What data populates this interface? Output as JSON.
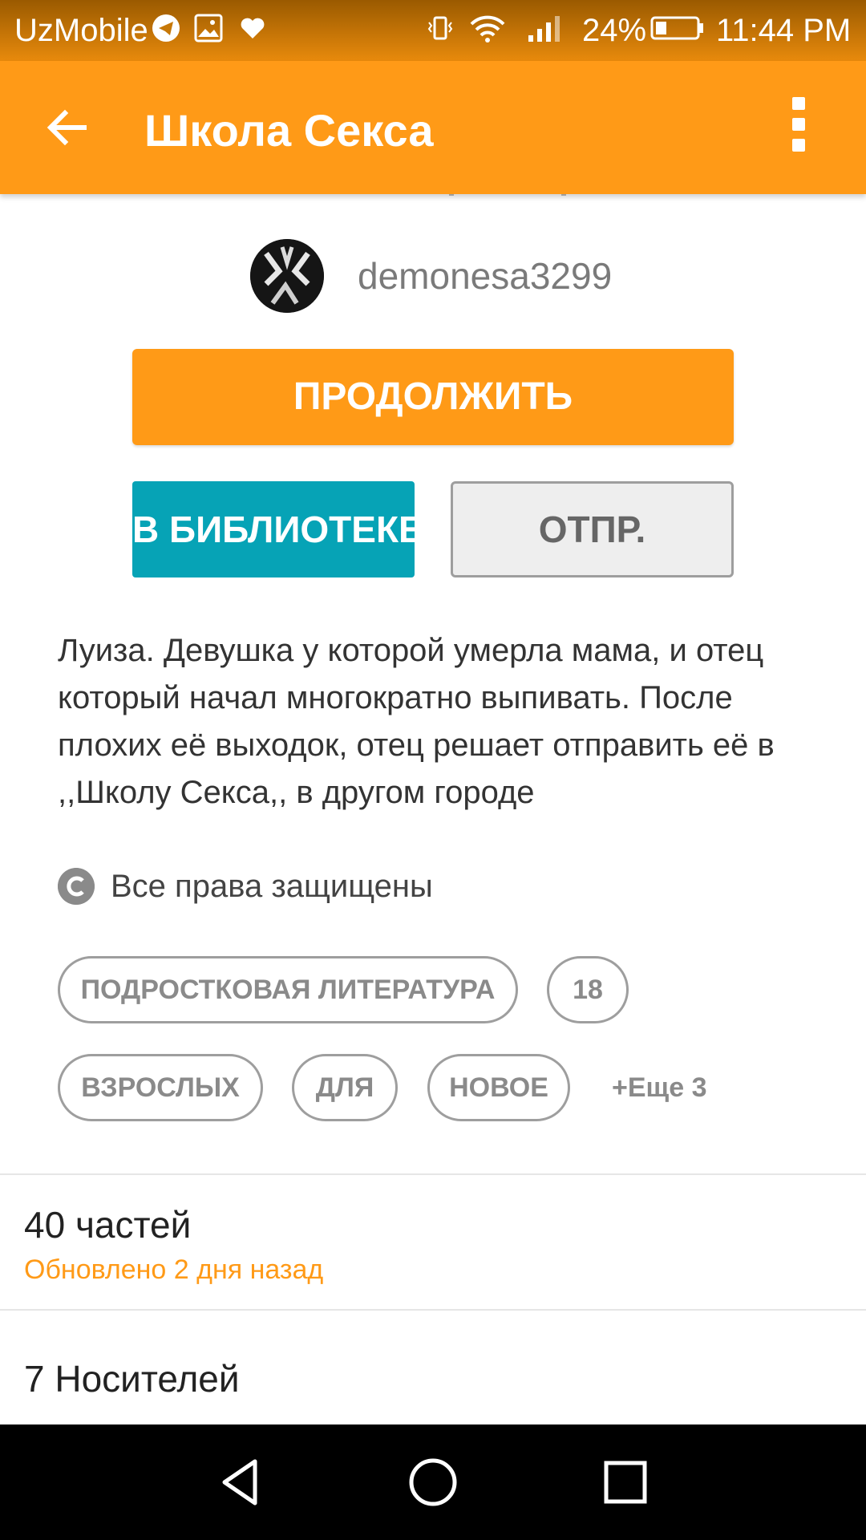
{
  "status_bar": {
    "carrier": "UzMobile",
    "battery": "24%",
    "time": "11:44 PM",
    "icons": [
      "telegram-icon",
      "gallery-icon",
      "heart-icon",
      "vibrate-icon",
      "wifi-icon",
      "signal-icon",
      "battery-icon"
    ]
  },
  "toolbar": {
    "title": "Школа Секса",
    "back_icon": "arrow-left-icon",
    "menu_icon": "more-vert-icon",
    "color": "#ff9a17"
  },
  "author": {
    "username": "demonesa3299"
  },
  "actions": {
    "continue_label": "ПРОДОЛЖИТЬ",
    "library_label": "В БИБЛИОТЕКЕ",
    "send_label": "ОТПР."
  },
  "description": {
    "text": "Луиза. Девушка у которой умерла мама, и отец который начал многократно выпивать. После плохих её выходок, отец решает отправить её в ,,Школу Секса,, в другом городе"
  },
  "copyright": {
    "label": "Все права защищены"
  },
  "tags": {
    "items": [
      "ПОДРОСТКОВАЯ ЛИТЕРАТУРА",
      "18",
      "ВЗРОСЛЫХ",
      "ДЛЯ",
      "НОВОЕ"
    ],
    "more_label": "+Еще 3"
  },
  "parts": {
    "count_label": "40 частей",
    "updated_label": "Обновлено 2 дня назад"
  },
  "carriers": {
    "label": "7 Носителей"
  },
  "nav_bar": {
    "icons": [
      "back-triangle-icon",
      "home-circle-icon",
      "recents-square-icon"
    ]
  }
}
